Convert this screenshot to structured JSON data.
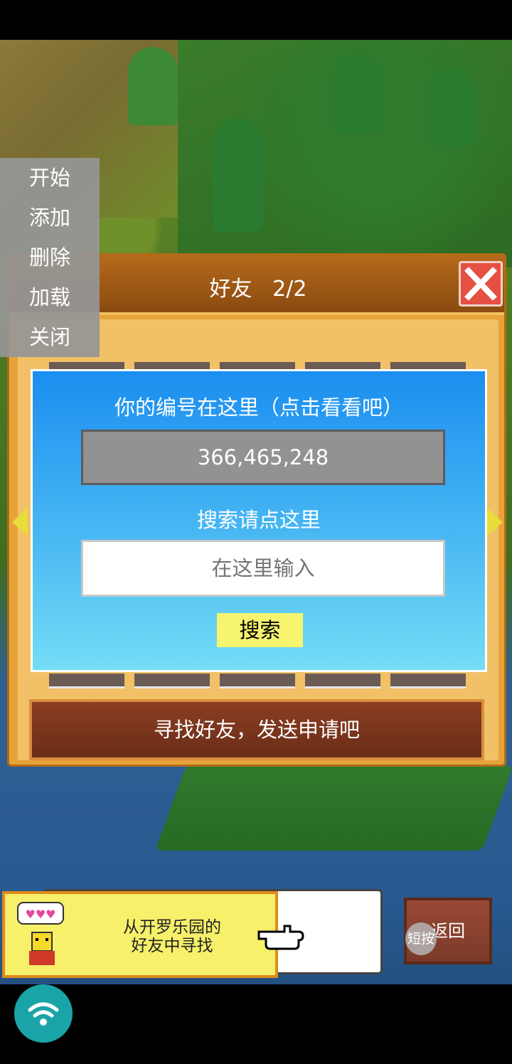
{
  "side_menu": {
    "items": [
      "开始",
      "添加",
      "删除",
      "加载",
      "关闭"
    ]
  },
  "dialog": {
    "title": "好友",
    "page": "2/2",
    "id_label": "你的编号在这里（点击看看吧）",
    "id_value": "366,465,248",
    "search_label": "搜索请点这里",
    "search_placeholder": "在这里输入",
    "search_button": "搜索",
    "find_friends_button": "寻找好友，发送申请吧"
  },
  "bottom": {
    "text_line1": "从开罗乐园的",
    "text_line2": "好友中寻找",
    "back_button": "返回",
    "short_press": "短按"
  },
  "colors": {
    "accent_yellow": "#f7f46e",
    "dialog_brown": "#b56a1b",
    "panel_blue": "#1b8ef0",
    "close_red": "#e55043"
  }
}
